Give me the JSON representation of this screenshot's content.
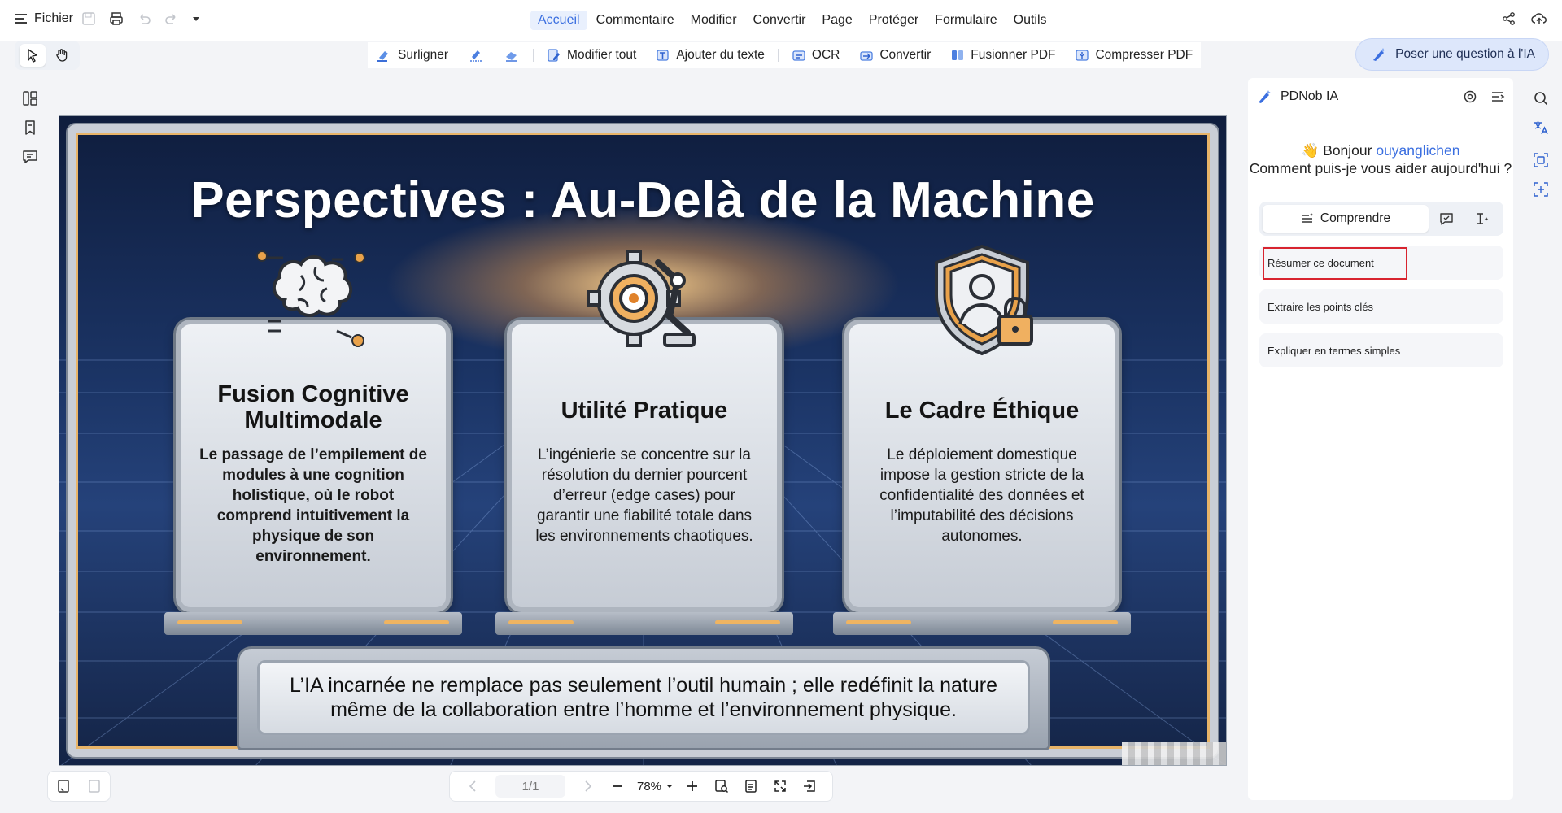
{
  "menu": {
    "file_label": "Fichier",
    "tabs": [
      "Accueil",
      "Commentaire",
      "Modifier",
      "Convertir",
      "Page",
      "Protéger",
      "Formulaire",
      "Outils"
    ],
    "active_tab": "Accueil"
  },
  "toolbar": {
    "highlight": "Surligner",
    "edit_all": "Modifier tout",
    "add_text": "Ajouter du texte",
    "ocr": "OCR",
    "convert": "Convertir",
    "merge": "Fusionner PDF",
    "compress": "Compresser PDF",
    "ask_ai": "Poser une question à l'IA"
  },
  "slide": {
    "title": "Perspectives : Au-Delà de la Machine",
    "cards": [
      {
        "title": "Fusion Cognitive Multimodale",
        "text": "Le passage de l’empilement de modules à une cognition holistique, où le robot comprend intuitivement la physique de son environnement.",
        "icon": "brain-icon"
      },
      {
        "title": "Utilité Pratique",
        "text": "L’ingénierie se concentre sur la résolution du dernier pourcent d’erreur (edge cases) pour garantir une fiabilité totale dans les environnements chaotiques.",
        "icon": "gear-robot-arm-icon"
      },
      {
        "title": "Le Cadre Éthique",
        "text": "Le déploiement domestique impose la gestion stricte de la confidentialité des données et l’imputabilité des décisions autonomes.",
        "icon": "shield-lock-icon"
      }
    ],
    "banner": "L’IA incarnée ne remplace pas seulement l’outil humain ; elle redéfinit la nature même de la collaboration entre l’homme et l’environnement physique."
  },
  "pager": {
    "page": "1/1",
    "zoom": "78%"
  },
  "ai": {
    "name": "PDNob IA",
    "greeting_prefix": "👋 Bonjour ",
    "user": "ouyanglichen",
    "question": "Comment puis-je vous aider aujourd'hui ?",
    "tab_label": "Comprendre",
    "suggestions": [
      "Résumer ce document",
      "Extraire les points clés",
      "Expliquer en termes simples"
    ]
  }
}
